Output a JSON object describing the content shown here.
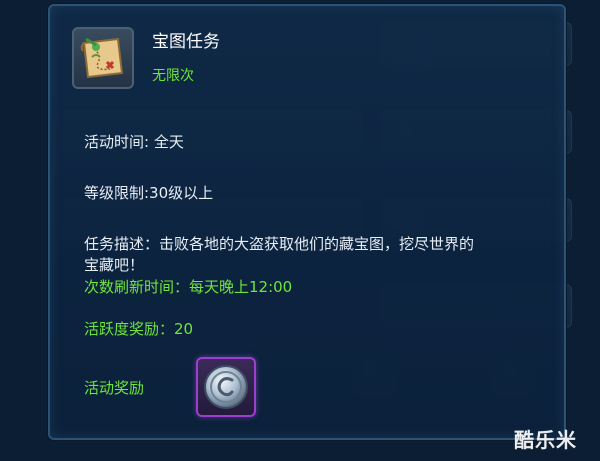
{
  "tooltip": {
    "title": "宝图任务",
    "subtitle": "无限次",
    "icon": "treasure-map-icon",
    "activity_time": "活动时间: 全天",
    "level_limit": "等级限制:30级以上",
    "description": "任务描述：击败各地的大盗获取他们的藏宝图，挖尽世界的宝藏吧！",
    "refresh_time": "次数刷新时间：每天晚上12:00",
    "activity_points": "活跃度奖励：20",
    "reward_label": "活动奖励",
    "reward_icon": "silver-coin-icon"
  },
  "watermark": "酷乐米",
  "colors": {
    "title": "#ffffff",
    "green": "#6fe63a",
    "text": "#e8eef5",
    "panel": "#0d2440",
    "reward_border": "#9b3fd1"
  }
}
